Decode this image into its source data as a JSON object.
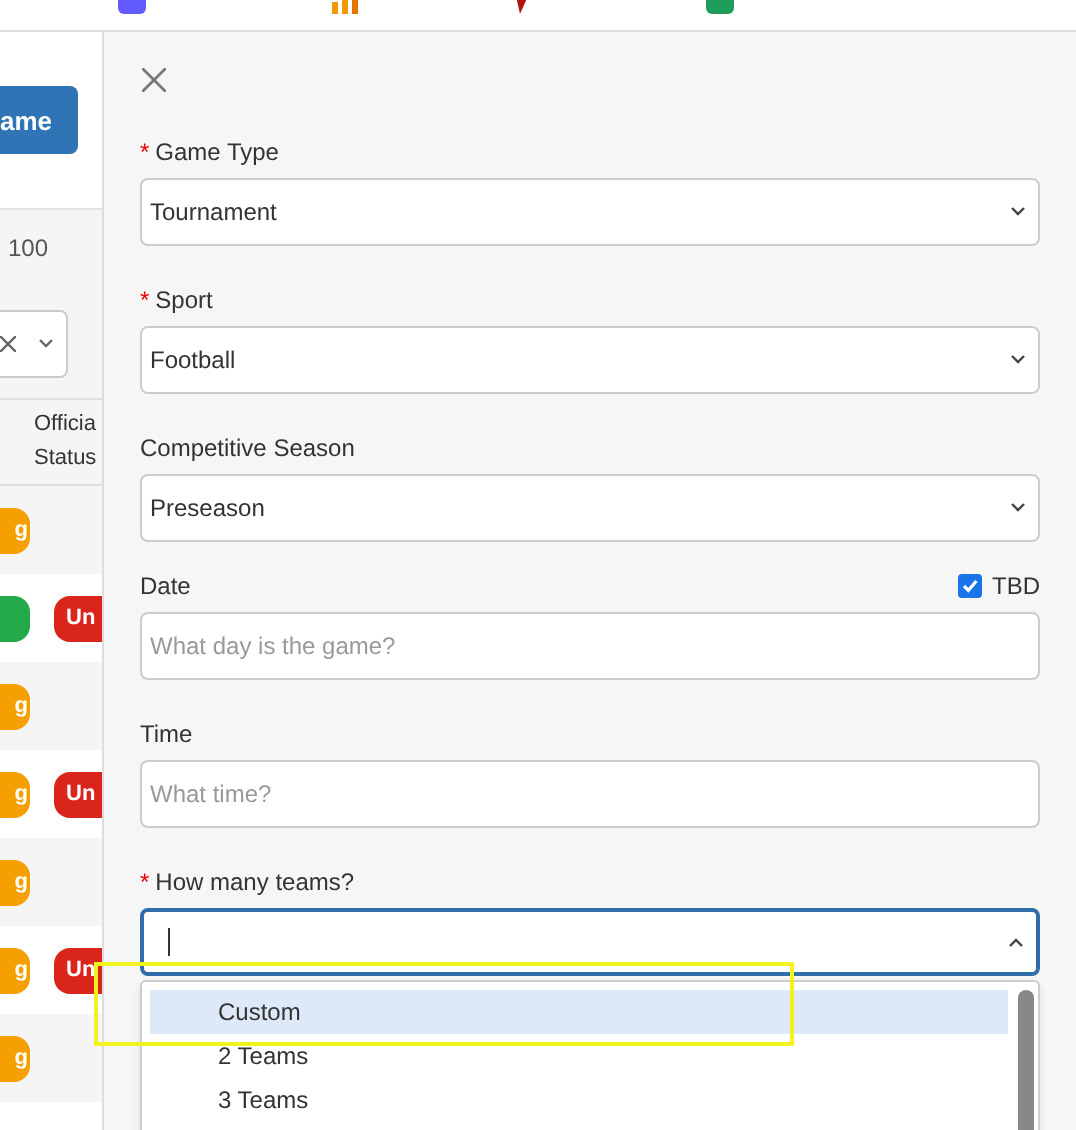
{
  "left_panel": {
    "button_label": "ame",
    "page_size": "100",
    "header": [
      "Officia",
      "Status"
    ],
    "rows": [
      {
        "kind": "pending",
        "badge": "g",
        "official": ""
      },
      {
        "kind": "confirmed",
        "badge": "",
        "official": "Un"
      },
      {
        "kind": "pending",
        "badge": "g",
        "official": ""
      },
      {
        "kind": "pending",
        "badge": "g",
        "official": "Un"
      },
      {
        "kind": "pending",
        "badge": "g",
        "official": ""
      },
      {
        "kind": "pending",
        "badge": "g",
        "official": "Un"
      },
      {
        "kind": "pending",
        "badge": "g",
        "official": ""
      }
    ]
  },
  "drawer": {
    "fields": [
      {
        "kind": "select",
        "required_mark": "*",
        "label": "Game Type",
        "value": "Tournament"
      },
      {
        "kind": "select",
        "required_mark": "*",
        "label": "Sport",
        "value": "Football"
      },
      {
        "kind": "select",
        "label": "Competitive Season",
        "value": "Preseason"
      },
      {
        "kind": "input",
        "label": "Date",
        "placeholder": "What day is the game?",
        "checkbox": {
          "label": "TBD",
          "checked": true
        }
      },
      {
        "kind": "input",
        "label": "Time",
        "placeholder": "What time?"
      },
      {
        "kind": "combobox",
        "required_mark": "*",
        "label": "How many teams?",
        "expanded": true,
        "options": [
          {
            "label": "Custom",
            "selected": true,
            "highlighted": true
          },
          {
            "label": "2 Teams",
            "selected": false,
            "highlighted": false
          },
          {
            "label": "3 Teams",
            "selected": false,
            "highlighted": false
          }
        ]
      }
    ]
  }
}
